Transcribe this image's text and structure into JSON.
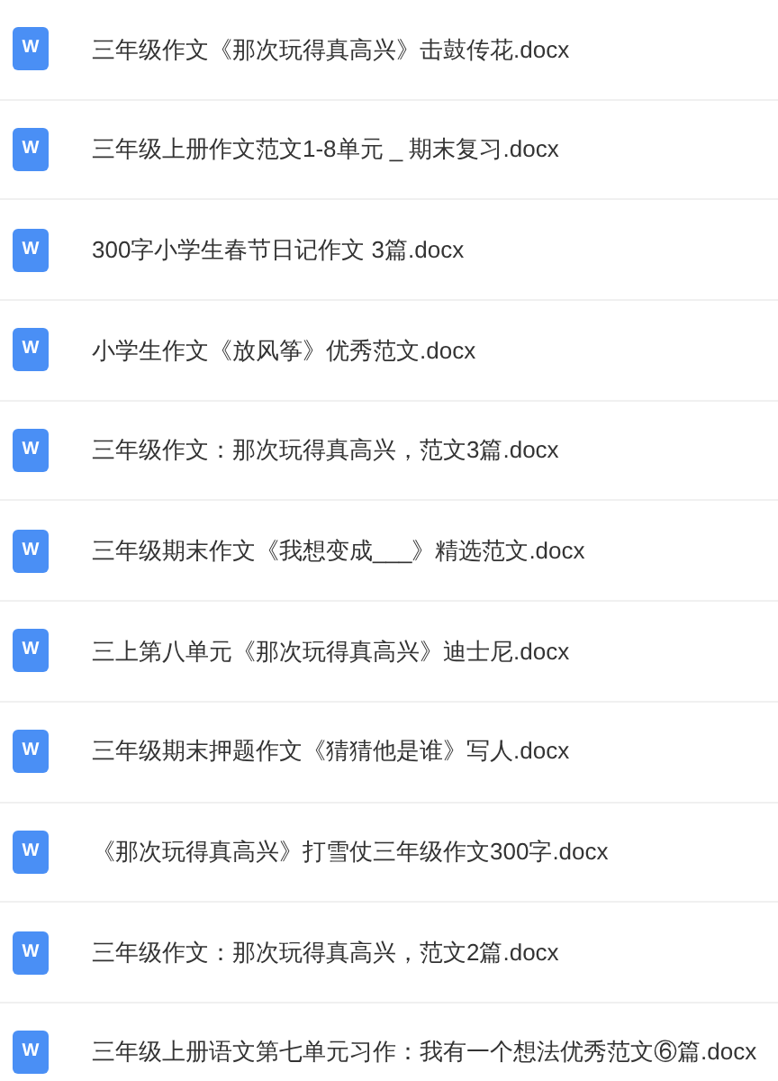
{
  "files": [
    {
      "name": "三年级作文《那次玩得真高兴》击鼓传花.docx",
      "icon_label": "W"
    },
    {
      "name": "三年级上册作文范文1-8单元 _ 期末复习.docx",
      "icon_label": "W"
    },
    {
      "name": "300字小学生春节日记作文 3篇.docx",
      "icon_label": "W"
    },
    {
      "name": "小学生作文《放风筝》优秀范文.docx",
      "icon_label": "W"
    },
    {
      "name": "三年级作文：那次玩得真高兴，范文3篇.docx",
      "icon_label": "W"
    },
    {
      "name": "三年级期末作文《我想变成___》精选范文.docx",
      "icon_label": "W"
    },
    {
      "name": "三上第八单元《那次玩得真高兴》迪士尼.docx",
      "icon_label": "W"
    },
    {
      "name": "三年级期末押题作文《猜猜他是谁》写人.docx",
      "icon_label": "W"
    },
    {
      "name": "《那次玩得真高兴》打雪仗三年级作文300字.docx",
      "icon_label": "W"
    },
    {
      "name": "三年级作文：那次玩得真高兴，范文2篇.docx",
      "icon_label": "W"
    },
    {
      "name": "三年级上册语文第七单元习作：我有一个想法优秀范文⑥篇.docx",
      "icon_label": "W"
    }
  ]
}
